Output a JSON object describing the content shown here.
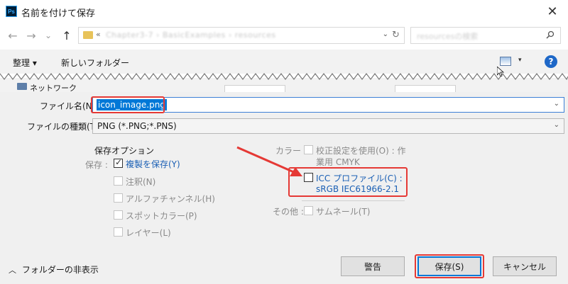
{
  "window": {
    "title": "名前を付けて保存",
    "app_icon": "Ps",
    "close": "✕"
  },
  "nav": {
    "back": "←",
    "forward": "→",
    "recent": "⌄",
    "up": "↑",
    "address_prefix": "«",
    "address_path": "Chapter3-7 › BasicExamples › resources",
    "refresh": "↻",
    "search_placeholder": "resourcesの検索"
  },
  "toolbar": {
    "organize": "整理 ▾",
    "new_folder": "新しいフォルダー",
    "view_dropdown": "▾",
    "help": "?"
  },
  "tree": {
    "network": "ネットワーク"
  },
  "form": {
    "filename_label": "ファイル名(N):",
    "filename_value": "icon_image.png",
    "filetype_label": "ファイルの種類(T):",
    "filetype_value": "PNG (*.PNG;*.PNS)",
    "dropdown_arrow": "⌄"
  },
  "save_options": {
    "heading": "保存オプション",
    "save_label": "保存 :",
    "items": [
      {
        "label": "複製を保存(Y)",
        "checked": true
      },
      {
        "label": "注釈(N)",
        "checked": false
      },
      {
        "label": "アルファチャンネル(H)",
        "checked": false
      },
      {
        "label": "スポットカラー(P)",
        "checked": false
      },
      {
        "label": "レイヤー(L)",
        "checked": false
      }
    ]
  },
  "color": {
    "label": "カラー :",
    "proof_line1": "校正設定を使用(O) : 作",
    "proof_line2": "業用 CMYK",
    "icc_line1": "ICC プロファイル(C) :",
    "icc_line2": "sRGB IEC61966-2.1"
  },
  "other": {
    "label": "その他 :",
    "thumbnail": "サムネール(T)"
  },
  "footer": {
    "hide_folders": "フォルダーの非表示",
    "warning_button": "警告",
    "save_button": "保存(S)",
    "cancel_button": "キャンセル"
  },
  "colors": {
    "accent": "#0078d7",
    "highlight": "#e53935",
    "link": "#1a5fb4"
  }
}
